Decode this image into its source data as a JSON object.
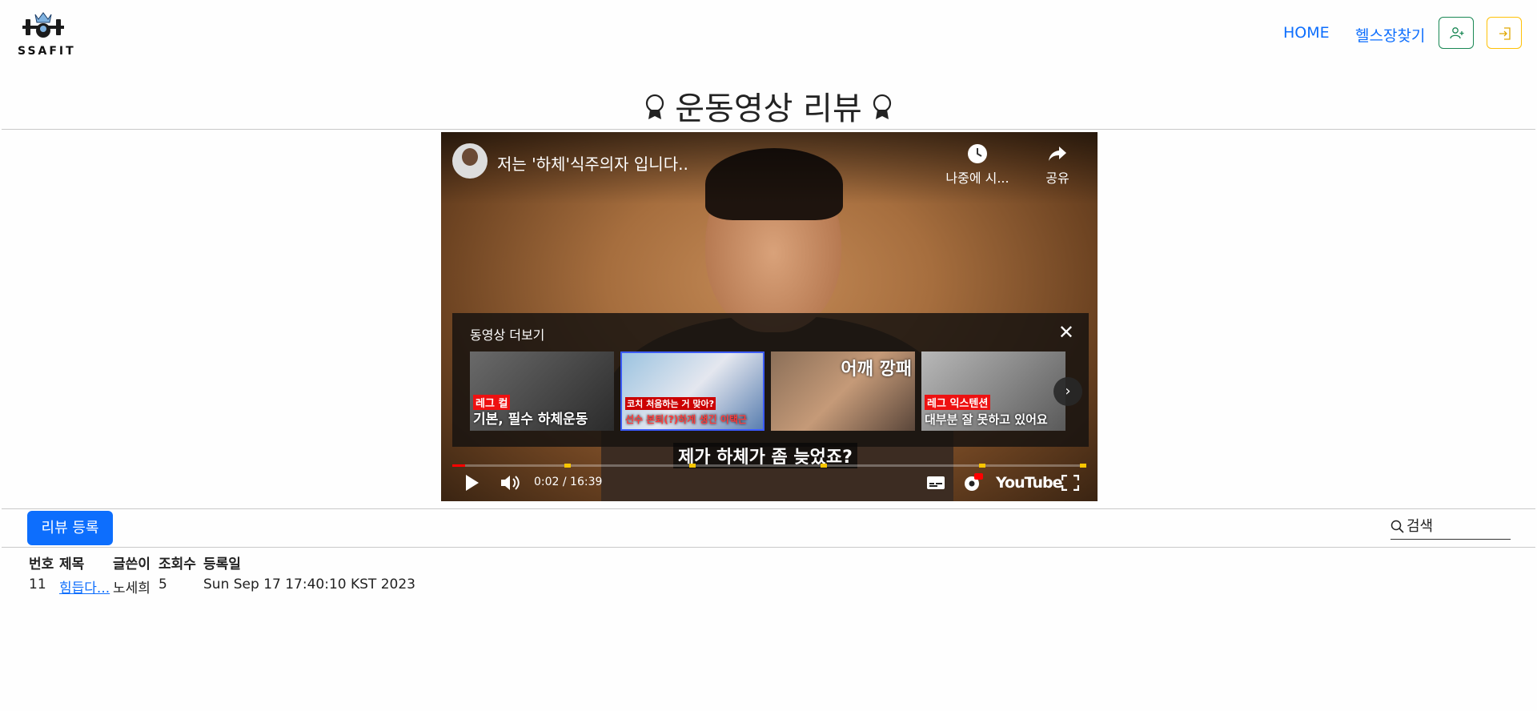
{
  "logo": {
    "text": "SSAFIT"
  },
  "nav": {
    "home": "HOME",
    "find_gym": "헬스장찾기",
    "signup_icon": "user-plus-icon",
    "login_icon": "login-icon"
  },
  "page_title": "운동영상 리뷰",
  "video": {
    "title": "저는 '하체'식주의자 입니다..",
    "watch_later": "나중에 시...",
    "share": "공유",
    "more_videos_title": "동영상 더보기",
    "thumbnails": [
      {
        "tag": "레그 컬",
        "caption": "기본, 필수 하체운동"
      },
      {
        "tag": "",
        "caption": "선수 본퇴(?)하게 생긴 이택근",
        "upper": "코치 처음하는 거 맞아?"
      },
      {
        "tag": "",
        "caption": "어깨 깡패",
        "upper": ""
      },
      {
        "tag": "레그 익스텐션",
        "caption": "대부분 잘 못하고 있어요"
      }
    ],
    "subtitle": "제가 하체가 좀 늦었죠?",
    "time": "0:02 / 16:39",
    "progress": 0.02,
    "brand": "YouTube"
  },
  "review_button": "리뷰 등록",
  "search": {
    "placeholder": "검색"
  },
  "table": {
    "headers": [
      "번호",
      "제목",
      "글쓴이",
      "조회수",
      "등록일"
    ],
    "rows": [
      {
        "no": "11",
        "title": "힘듭다...",
        "author": "노세희",
        "views": "5",
        "date": "Sun Sep 17 17:40:10 KST 2023"
      }
    ]
  }
}
